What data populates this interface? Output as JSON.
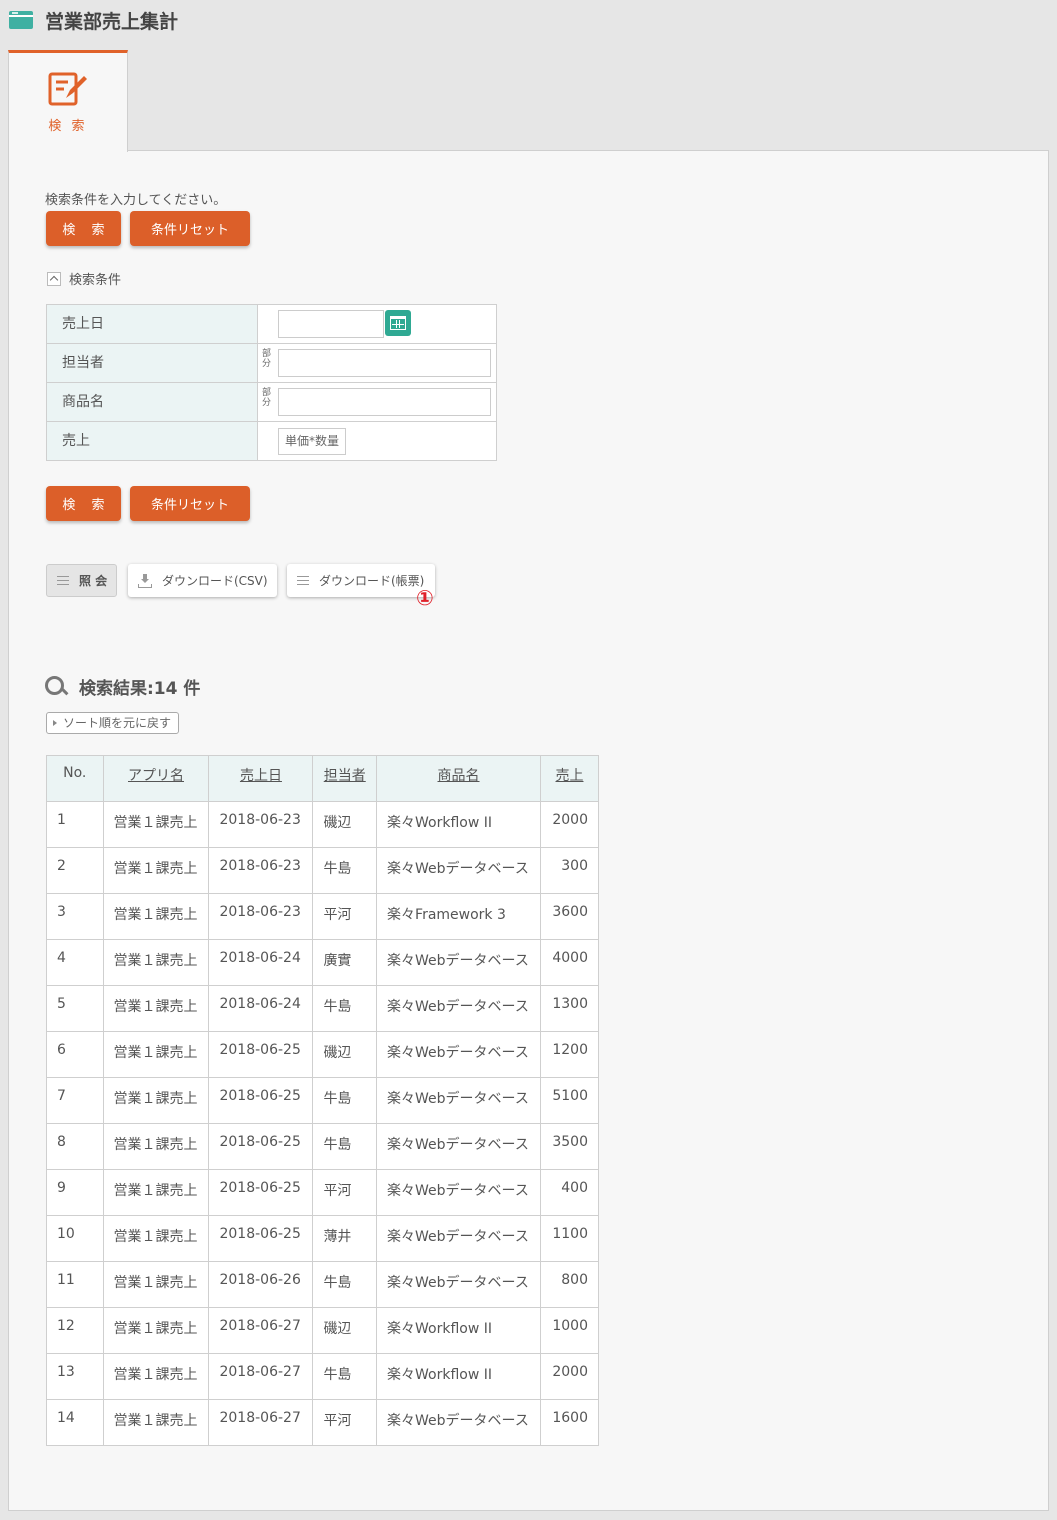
{
  "header": {
    "title": "営業部売上集計",
    "icon": "window-icon"
  },
  "tab": {
    "label": "検 索",
    "icon": "edit-icon",
    "accent": "#e0622a"
  },
  "search": {
    "instruction": "検索条件を入力してください。",
    "search_label": "検 索",
    "reset_label": "条件リセット",
    "conditions_label": "検索条件",
    "fields": [
      {
        "label": "売上日",
        "type": "date",
        "value": ""
      },
      {
        "label": "担当者",
        "type": "text",
        "badge": "部分",
        "value": ""
      },
      {
        "label": "商品名",
        "type": "text",
        "badge": "部分",
        "value": ""
      },
      {
        "label": "売上",
        "type": "formula",
        "value": "単価*数量"
      }
    ]
  },
  "toolbar": {
    "inquiry": "照 会",
    "download_csv": "ダウンロード(CSV)",
    "download_report": "ダウンロード(帳票)",
    "marker": "①"
  },
  "results": {
    "heading": "検索結果:14 件",
    "sort_reset": "ソート順を元に戻す",
    "columns": [
      "No.",
      "アプリ名",
      "売上日",
      "担当者",
      "商品名",
      "売上"
    ],
    "rows": [
      [
        "1",
        "営業１課売上",
        "2018-06-23",
        "磯辺",
        "楽々Workflow II",
        "2000"
      ],
      [
        "2",
        "営業１課売上",
        "2018-06-23",
        "牛島",
        "楽々Webデータベース",
        "300"
      ],
      [
        "3",
        "営業１課売上",
        "2018-06-23",
        "平河",
        "楽々Framework 3",
        "3600"
      ],
      [
        "4",
        "営業１課売上",
        "2018-06-24",
        "廣實",
        "楽々Webデータベース",
        "4000"
      ],
      [
        "5",
        "営業１課売上",
        "2018-06-24",
        "牛島",
        "楽々Webデータベース",
        "1300"
      ],
      [
        "6",
        "営業１課売上",
        "2018-06-25",
        "磯辺",
        "楽々Webデータベース",
        "1200"
      ],
      [
        "7",
        "営業１課売上",
        "2018-06-25",
        "牛島",
        "楽々Webデータベース",
        "5100"
      ],
      [
        "8",
        "営業１課売上",
        "2018-06-25",
        "牛島",
        "楽々Webデータベース",
        "3500"
      ],
      [
        "9",
        "営業１課売上",
        "2018-06-25",
        "平河",
        "楽々Webデータベース",
        "400"
      ],
      [
        "10",
        "営業１課売上",
        "2018-06-25",
        "薄井",
        "楽々Webデータベース",
        "1100"
      ],
      [
        "11",
        "営業１課売上",
        "2018-06-26",
        "牛島",
        "楽々Webデータベース",
        "800"
      ],
      [
        "12",
        "営業１課売上",
        "2018-06-27",
        "磯辺",
        "楽々Workflow II",
        "1000"
      ],
      [
        "13",
        "営業１課売上",
        "2018-06-27",
        "牛島",
        "楽々Workflow II",
        "2000"
      ],
      [
        "14",
        "営業１課売上",
        "2018-06-27",
        "平河",
        "楽々Webデータベース",
        "1600"
      ]
    ]
  },
  "colors": {
    "primary_button": "#dc5f29",
    "header_cell": "#ebf4f4",
    "calendar_button": "#2fa993",
    "marker": "#e0212a"
  }
}
